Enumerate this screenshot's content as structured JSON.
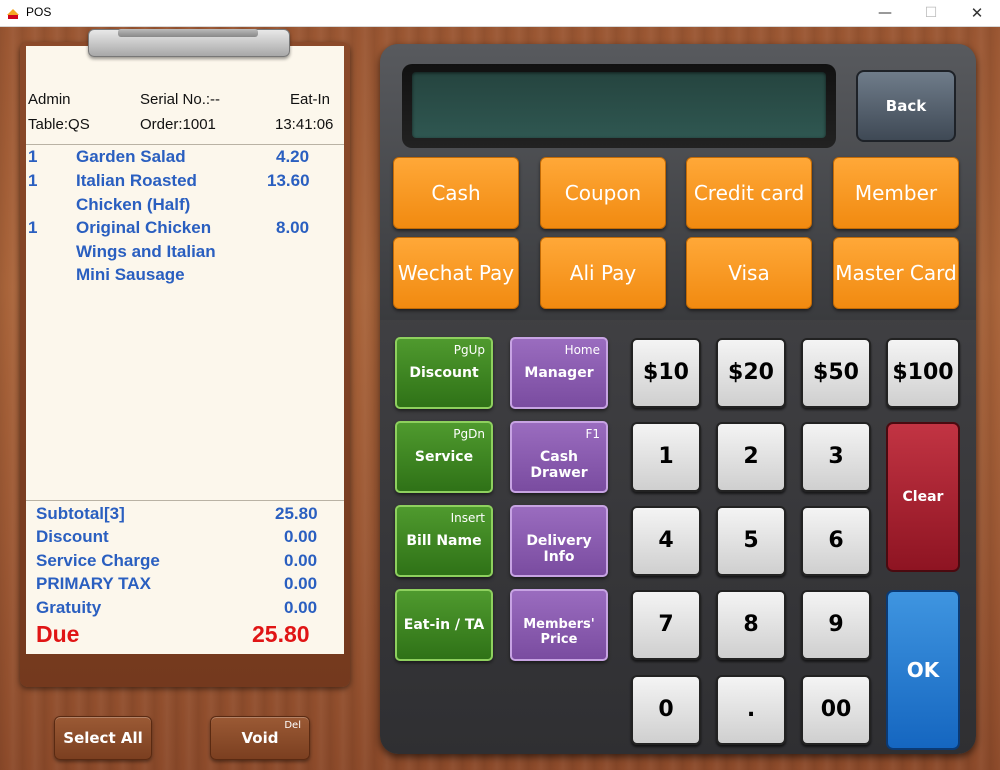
{
  "window": {
    "title": "POS",
    "minimize": "—",
    "maximize": "☐",
    "close": "✕"
  },
  "receipt": {
    "user": "Admin",
    "serial": "Serial No.:--",
    "mode": "Eat-In",
    "table": "Table:QS",
    "order": "Order:1001",
    "time": "13:41:06",
    "items": [
      {
        "qty": "1",
        "name": "Garden Salad",
        "price": "4.20"
      },
      {
        "qty": "1",
        "name": "Italian Roasted Chicken (Half)",
        "price": "13.60"
      },
      {
        "qty": "1",
        "name": "Original Chicken Wings and Italian Mini Sausage",
        "price": "8.00"
      }
    ],
    "totals": {
      "subtotal_label": "Subtotal[3]",
      "subtotal": "25.80",
      "discount_label": "Discount",
      "discount": "0.00",
      "service_label": "Service Charge",
      "service": "0.00",
      "tax_label": "PRIMARY TAX",
      "tax": "0.00",
      "gratuity_label": "Gratuity",
      "gratuity": "0.00",
      "due_label": "Due",
      "due": "25.80"
    }
  },
  "bottom": {
    "select_all": "Select All",
    "void": "Void",
    "void_hint": "Del"
  },
  "calc": {
    "back": "Back",
    "payments": [
      "Cash",
      "Coupon",
      "Credit card",
      "Member",
      "Wechat Pay",
      "Ali Pay",
      "Visa",
      "Master Card"
    ],
    "functions": [
      {
        "label": "Discount",
        "hint": "PgUp"
      },
      {
        "label": "Manager",
        "hint": "Home"
      },
      {
        "label": "Service",
        "hint": "PgDn"
      },
      {
        "label": "Cash Drawer",
        "hint": "F1"
      },
      {
        "label": "Bill Name",
        "hint": "Insert"
      },
      {
        "label": "Delivery Info",
        "hint": ""
      },
      {
        "label": "Eat-in / TA",
        "hint": ""
      },
      {
        "label": "Members' Price",
        "hint": ""
      }
    ],
    "quick": [
      "$10",
      "$20",
      "$50",
      "$100"
    ],
    "digits": [
      "1",
      "2",
      "3",
      "4",
      "5",
      "6",
      "7",
      "8",
      "9",
      "0",
      ".",
      "00"
    ],
    "clear": "Clear",
    "ok": "OK"
  },
  "colors": {
    "orange": "#f5951f",
    "green": "#3f8a24",
    "purple": "#8a5bb0",
    "red": "#a8202e",
    "blue": "#2479d0",
    "item_text": "#2a5fc0",
    "due_text": "#e01515"
  }
}
